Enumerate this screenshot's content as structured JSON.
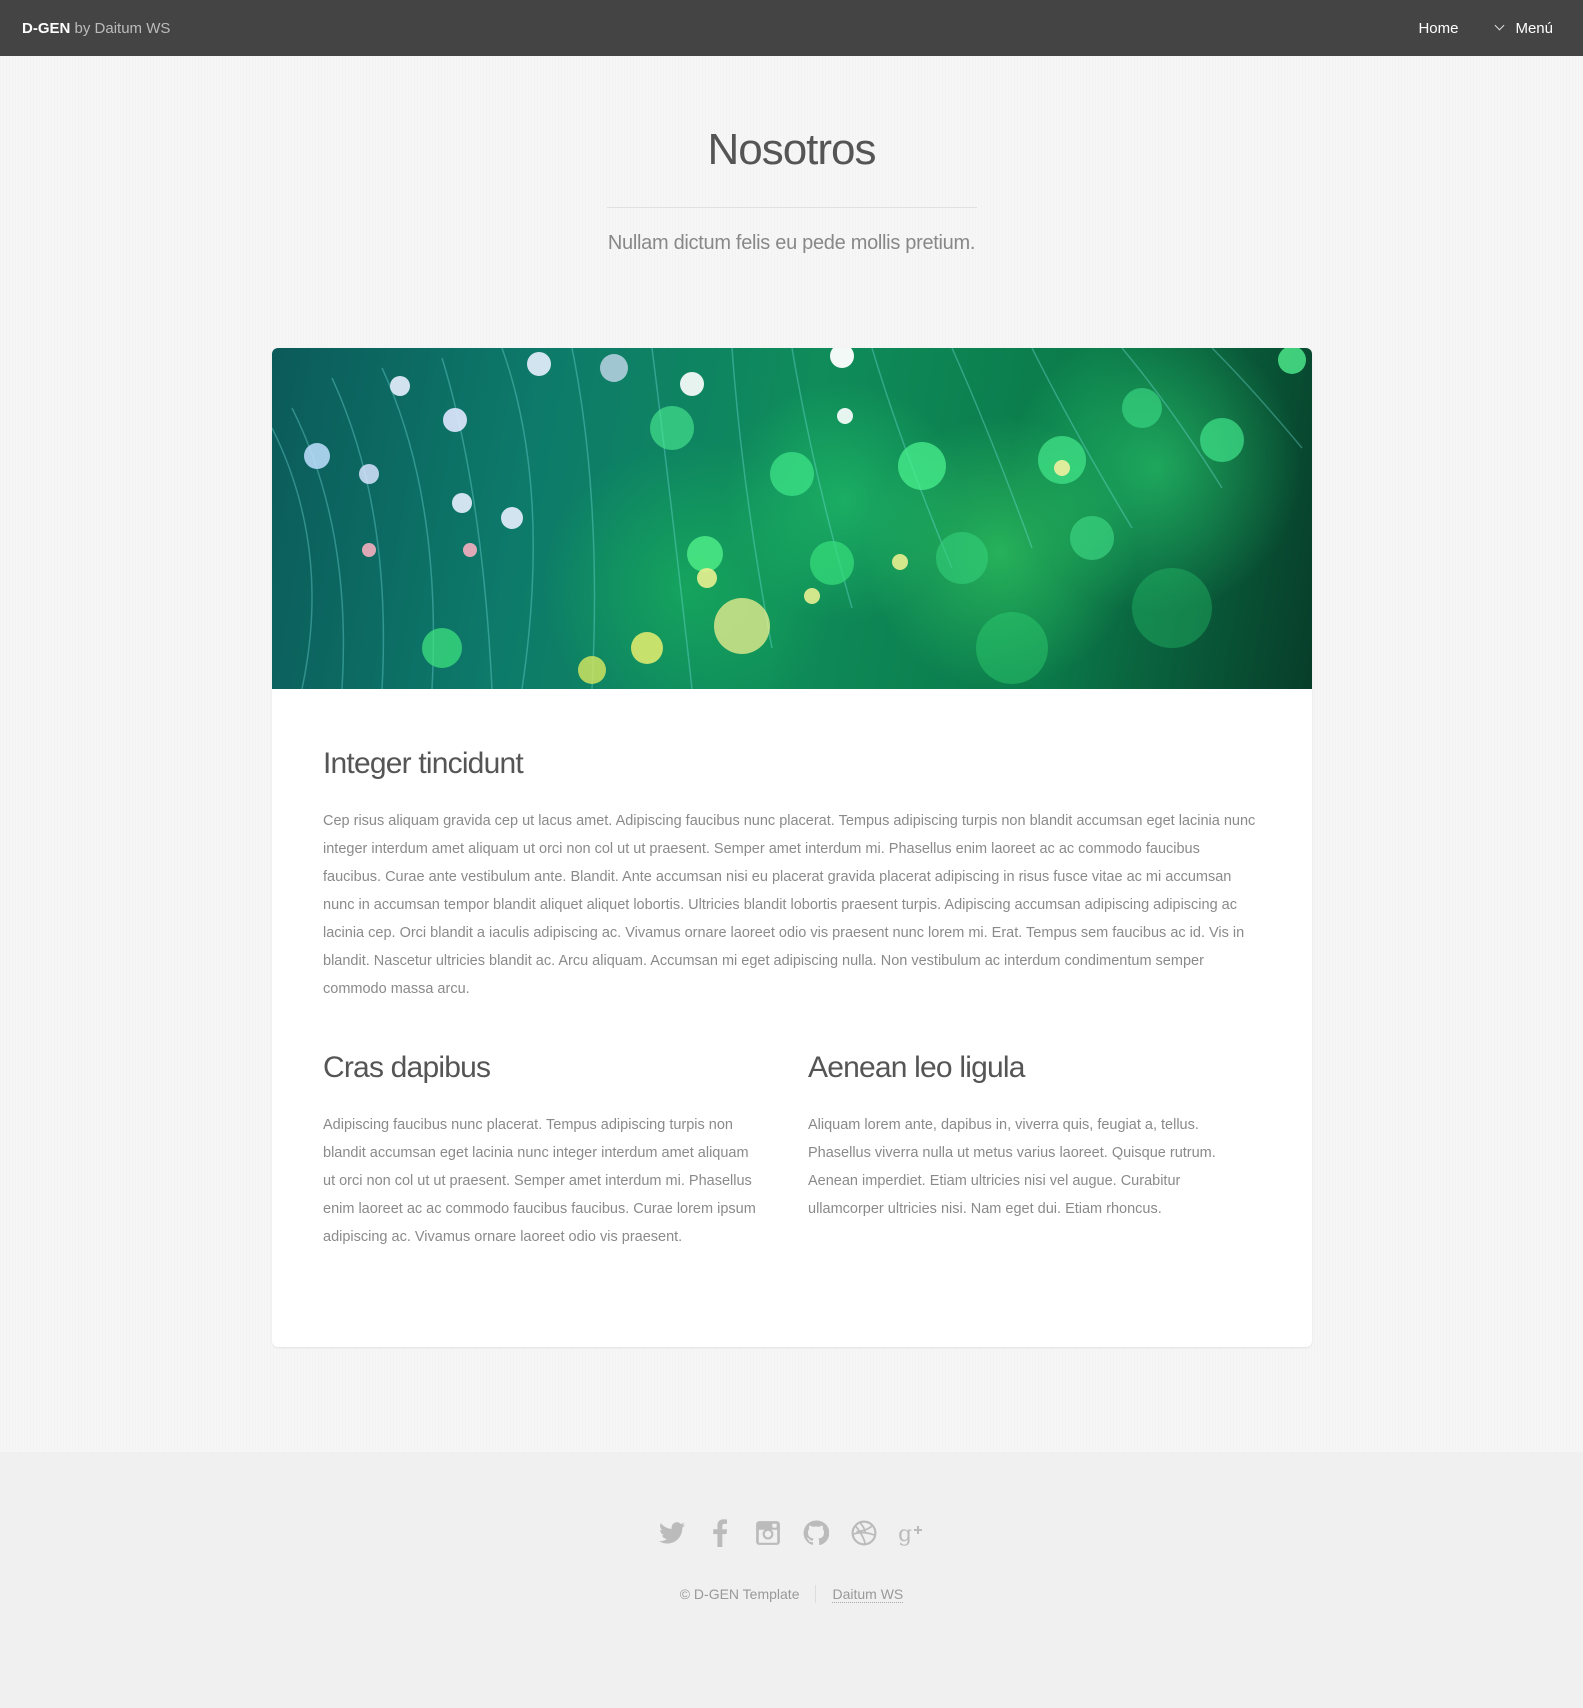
{
  "header": {
    "brand": "D-GEN",
    "by_text": " by Daitum WS",
    "nav": {
      "home": "Home",
      "menu": "Menú"
    }
  },
  "page": {
    "title": "Nosotros",
    "subtitle": "Nullam dictum felis eu pede mollis pretium."
  },
  "article": {
    "section1": {
      "heading": "Integer tincidunt",
      "body": "Cep risus aliquam gravida cep ut lacus amet. Adipiscing faucibus nunc placerat. Tempus adipiscing turpis non blandit accumsan eget lacinia nunc integer interdum amet aliquam ut orci non col ut ut praesent. Semper amet interdum mi. Phasellus enim laoreet ac ac commodo faucibus faucibus. Curae ante vestibulum ante. Blandit. Ante accumsan nisi eu placerat gravida placerat adipiscing in risus fusce vitae ac mi accumsan nunc in accumsan tempor blandit aliquet aliquet lobortis. Ultricies blandit lobortis praesent turpis. Adipiscing accumsan adipiscing adipiscing ac lacinia cep. Orci blandit a iaculis adipiscing ac. Vivamus ornare laoreet odio vis praesent nunc lorem mi. Erat. Tempus sem faucibus ac id. Vis in blandit. Nascetur ultricies blandit ac. Arcu aliquam. Accumsan mi eget adipiscing nulla. Non vestibulum ac interdum condimentum semper commodo massa arcu."
    },
    "section2": {
      "heading": "Cras dapibus",
      "body": "Adipiscing faucibus nunc placerat. Tempus adipiscing turpis non blandit accumsan eget lacinia nunc integer interdum amet aliquam ut orci non col ut ut praesent. Semper amet interdum mi. Phasellus enim laoreet ac ac commodo faucibus faucibus. Curae lorem ipsum adipiscing ac. Vivamus ornare laoreet odio vis praesent."
    },
    "section3": {
      "heading": "Aenean leo ligula",
      "body": "Aliquam lorem ante, dapibus in, viverra quis, feugiat a, tellus. Phasellus viverra nulla ut metus varius laoreet. Quisque rutrum. Aenean imperdiet. Etiam ultricies nisi vel augue. Curabitur ullamcorper ultricies nisi. Nam eget dui. Etiam rhoncus."
    }
  },
  "footer": {
    "social_icons": [
      "twitter-icon",
      "facebook-icon",
      "instagram-icon",
      "github-icon",
      "dribbble-icon",
      "google-plus-icon"
    ],
    "copyright": "© D-GEN Template",
    "credit_link": "Daitum WS"
  },
  "colors": {
    "header_bg": "#444444",
    "page_bg": "#f6f6f6",
    "footer_bg": "#f0f0f0",
    "icon": "#bbbbbb"
  }
}
